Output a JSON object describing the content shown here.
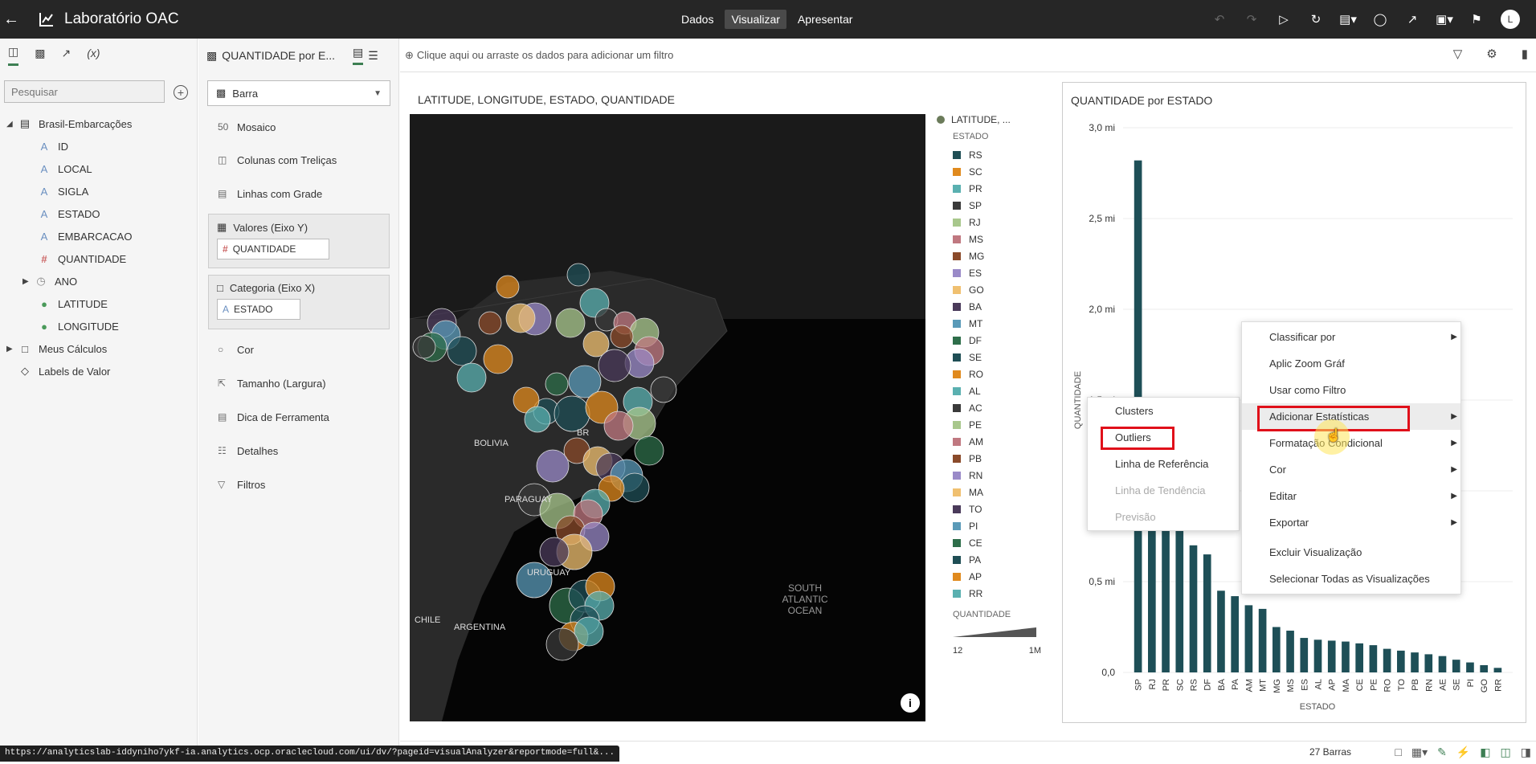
{
  "topbar": {
    "title": "Laboratório OAC",
    "modes": [
      "Dados",
      "Visualizar",
      "Apresentar"
    ],
    "active_mode": "Visualizar",
    "user_initial": "L"
  },
  "data_panel": {
    "search_placeholder": "Pesquisar",
    "dataset": "Brasil-Embarcações",
    "fields": [
      {
        "name": "ID",
        "type": "attribute"
      },
      {
        "name": "LOCAL",
        "type": "attribute"
      },
      {
        "name": "SIGLA",
        "type": "attribute"
      },
      {
        "name": "ESTADO",
        "type": "attribute"
      },
      {
        "name": "EMBARCACAO",
        "type": "attribute"
      },
      {
        "name": "QUANTIDADE",
        "type": "measure"
      },
      {
        "name": "ANO",
        "type": "time"
      },
      {
        "name": "LATITUDE",
        "type": "geo"
      },
      {
        "name": "LONGITUDE",
        "type": "geo"
      }
    ],
    "folders": [
      "Meus Cálculos",
      "Labels de Valor"
    ]
  },
  "grammar_panel": {
    "header": "QUANTIDADE por E...",
    "vis_type": "Barra",
    "items_top": [
      "Mosaico",
      "Colunas com Treliças",
      "Linhas com Grade"
    ],
    "values_label": "Valores (Eixo Y)",
    "values_field": "QUANTIDADE",
    "category_label": "Categoria (Eixo X)",
    "category_field": "ESTADO",
    "items_bottom": [
      "Cor",
      "Tamanho (Largura)",
      "Dica de Ferramenta",
      "Detalhes",
      "Filtros"
    ]
  },
  "filterbar": {
    "placeholder": "Clique aqui ou arraste os dados para adicionar um filtro"
  },
  "map_viz": {
    "title": "LATITUDE, LONGITUDE, ESTADO, QUANTIDADE",
    "labels": [
      "BOLIVIA",
      "BR",
      "PARAGUAY",
      "URUGUAY",
      "CHILE",
      "ARGENTINA",
      "SOUTH",
      "ATLANTIC",
      "OCEAN"
    ],
    "legend_head": "LATITUDE, ...",
    "legend_sub": "ESTADO",
    "legend": [
      {
        "name": "RS",
        "color": "#1f4e55"
      },
      {
        "name": "SC",
        "color": "#e08a1e"
      },
      {
        "name": "PR",
        "color": "#5ab0b0"
      },
      {
        "name": "SP",
        "color": "#3a3a3a"
      },
      {
        "name": "RJ",
        "color": "#a8c78c"
      },
      {
        "name": "MS",
        "color": "#c07880"
      },
      {
        "name": "MG",
        "color": "#8a4a2a"
      },
      {
        "name": "ES",
        "color": "#9a8ac8"
      },
      {
        "name": "GO",
        "color": "#f0c070"
      },
      {
        "name": "BA",
        "color": "#4a3a5a"
      },
      {
        "name": "MT",
        "color": "#5a9ab8"
      },
      {
        "name": "DF",
        "color": "#2e6e4a"
      },
      {
        "name": "SE",
        "color": "#1f4e55"
      },
      {
        "name": "RO",
        "color": "#e08a1e"
      },
      {
        "name": "AL",
        "color": "#5ab0b0"
      },
      {
        "name": "AC",
        "color": "#3a3a3a"
      },
      {
        "name": "PE",
        "color": "#a8c78c"
      },
      {
        "name": "AM",
        "color": "#c07880"
      },
      {
        "name": "PB",
        "color": "#8a4a2a"
      },
      {
        "name": "RN",
        "color": "#9a8ac8"
      },
      {
        "name": "MA",
        "color": "#f0c070"
      },
      {
        "name": "TO",
        "color": "#4a3a5a"
      },
      {
        "name": "PI",
        "color": "#5a9ab8"
      },
      {
        "name": "CE",
        "color": "#2e6e4a"
      },
      {
        "name": "PA",
        "color": "#1f4e55"
      },
      {
        "name": "AP",
        "color": "#e08a1e"
      },
      {
        "name": "RR",
        "color": "#5ab0b0"
      }
    ],
    "size_label": "QUANTIDADE",
    "size_min": "12",
    "size_max": "1M"
  },
  "bar_viz": {
    "title": "QUANTIDADE por ESTADO"
  },
  "chart_data": {
    "type": "bar",
    "title": "QUANTIDADE por ESTADO",
    "xlabel": "ESTADO",
    "ylabel": "QUANTIDADE",
    "ylim": [
      0,
      3000000
    ],
    "yticks": [
      "0,0",
      "0,5 mi",
      "1,0 mi",
      "1,5 mi",
      "2,0 mi",
      "2,5 mi",
      "3,0 mi"
    ],
    "color": "#1e4f57",
    "categories": [
      "SP",
      "RJ",
      "PR",
      "SC",
      "RS",
      "DF",
      "BA",
      "PA",
      "AM",
      "MT",
      "MG",
      "MS",
      "ES",
      "AL",
      "AP",
      "MA",
      "CE",
      "PE",
      "RO",
      "TO",
      "PB",
      "RN",
      "AE",
      "SE",
      "PI",
      "GO",
      "RR"
    ],
    "values": [
      2820000,
      1050000,
      1000000,
      900000,
      700000,
      650000,
      450000,
      420000,
      370000,
      350000,
      250000,
      230000,
      190000,
      180000,
      175000,
      170000,
      160000,
      150000,
      130000,
      120000,
      110000,
      100000,
      90000,
      70000,
      55000,
      40000,
      25000
    ]
  },
  "context_menu": {
    "items": [
      {
        "label": "Classificar por",
        "sub": true
      },
      {
        "label": "Aplic Zoom Gráf",
        "sub": false
      },
      {
        "label": "Usar como Filtro",
        "sub": false
      },
      {
        "label": "Adicionar Estatísticas",
        "sub": true
      },
      {
        "label": "Formatação Condicional",
        "sub": true
      },
      {
        "label": "Cor",
        "sub": true
      },
      {
        "label": "Editar",
        "sub": true
      },
      {
        "label": "Exportar",
        "sub": true
      },
      {
        "label": "Excluir Visualização",
        "sub": false
      },
      {
        "label": "Selecionar Todas as Visualizações",
        "sub": false
      }
    ]
  },
  "submenu": {
    "items": [
      {
        "label": "Clusters",
        "disabled": false
      },
      {
        "label": "Outliers",
        "disabled": false
      },
      {
        "label": "Linha de Referência",
        "disabled": false
      },
      {
        "label": "Linha de Tendência",
        "disabled": true
      },
      {
        "label": "Previsão",
        "disabled": true
      }
    ]
  },
  "statusbar": {
    "count": "27 Barras",
    "url": "https://analyticslab-iddyniho7ykf-ia.analytics.ocp.oraclecloud.com/ui/dv/?pageid=visualAnalyzer&reportmode=full&..."
  }
}
